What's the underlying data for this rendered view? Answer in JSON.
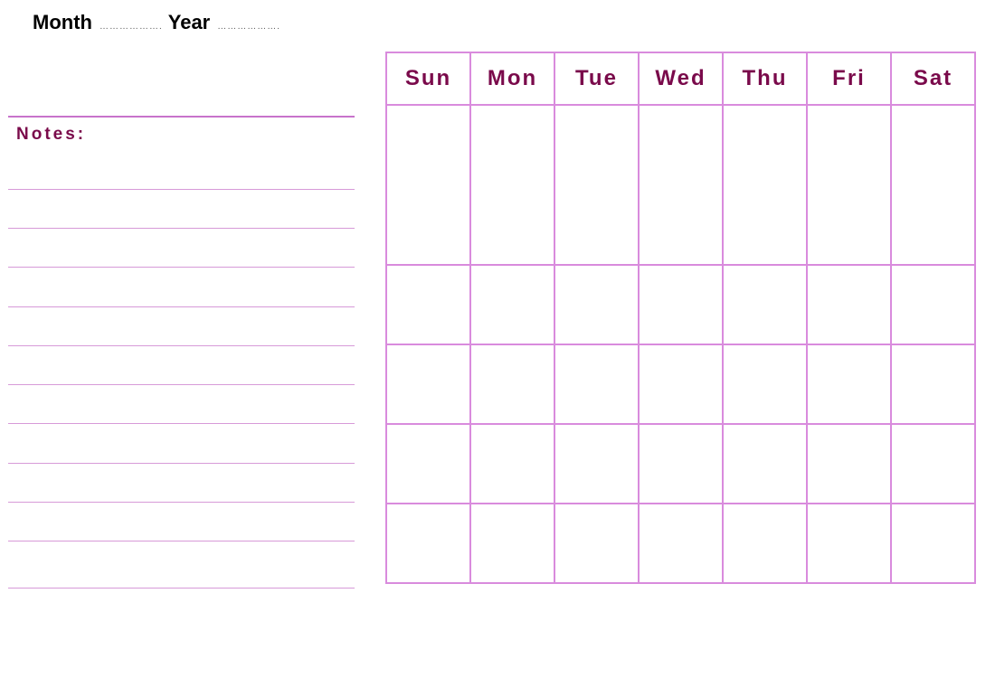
{
  "header": {
    "month_label": "Month",
    "month_blank": "……………….",
    "year_label": "Year",
    "year_blank": "………………."
  },
  "notes": {
    "label": "Notes:",
    "line_count": 11
  },
  "calendar": {
    "days": [
      "Sun",
      "Mon",
      "Tue",
      "Wed",
      "Thu",
      "Fri",
      "Sat"
    ],
    "week_rows": 5
  },
  "colors": {
    "heading": "#7a0a4b",
    "grid": "#d98bdd"
  }
}
